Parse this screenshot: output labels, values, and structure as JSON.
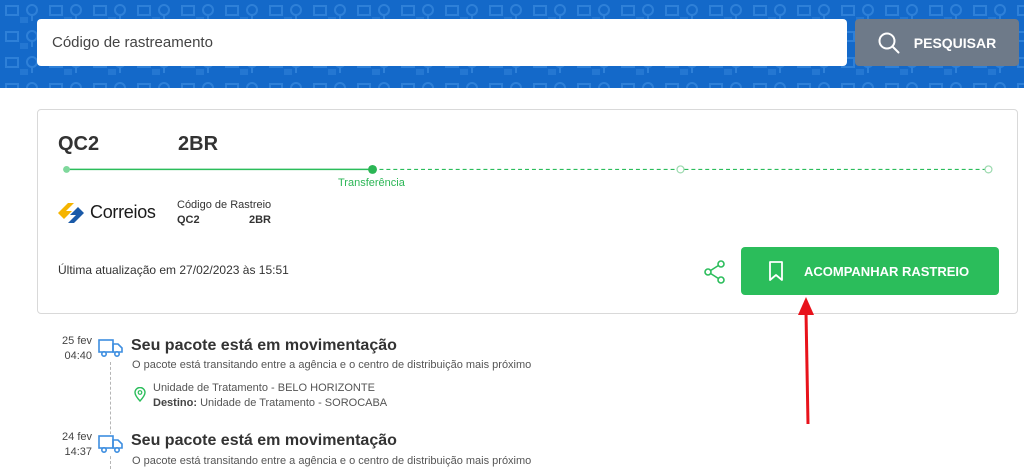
{
  "search": {
    "placeholder": "Código de rastreamento",
    "button_label": "PESQUISAR"
  },
  "package": {
    "code_part1": "QC2",
    "code_part2": "2BR",
    "progress_step_label": "Transferência",
    "progress_steps_total": 5,
    "progress_current_step": 2,
    "carrier_name": "Correios",
    "tracking_code_label": "Código de Rastreio",
    "last_update": "Última atualização em 27/02/2023 às 15:51",
    "follow_button_label": "ACOMPANHAR RASTREIO"
  },
  "events": [
    {
      "date": "25 fev",
      "time": "04:40",
      "title": "Seu pacote está em movimentação",
      "description": "O pacote está transitando entre a agência e o centro de distribuição mais próximo",
      "origin": "Unidade de Tratamento - BELO HORIZONTE",
      "destination_label": "Destino:",
      "destination": "Unidade de Tratamento - SOROCABA"
    },
    {
      "date": "24 fev",
      "time": "14:37",
      "title": "Seu pacote está em movimentação",
      "description": "O pacote está transitando entre a agência e o centro de distribuição mais próximo"
    }
  ],
  "icons": {
    "search": "search-icon",
    "share": "share-icon",
    "bookmark": "bookmark-icon",
    "truck": "truck-icon",
    "location": "location-pin-icon",
    "annotation": "red-arrow-icon"
  },
  "colors": {
    "header_bg": "#1469c9",
    "search_button_bg": "#6e7a89",
    "accent_green": "#2bbd5b",
    "truck_blue": "#3d8ee0",
    "annotation_red": "#e8121b"
  }
}
